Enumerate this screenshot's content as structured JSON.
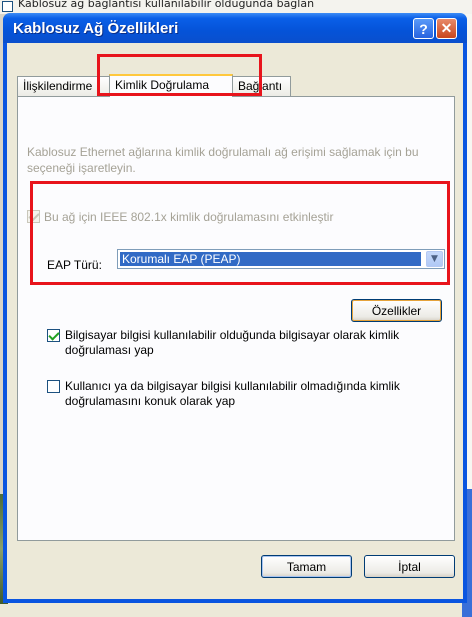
{
  "background": {
    "partial_text": "Kablosuz ağ bağlantısı kullanılabilir olduğunda bağlan"
  },
  "window": {
    "title": "Kablosuz Ağ Özellikleri",
    "help_glyph": "?",
    "close_glyph": "✕"
  },
  "tabs": [
    {
      "label": "İlişkilendirme",
      "active": false
    },
    {
      "label": "Kimlik Doğrulama",
      "active": true
    },
    {
      "label": "Bağlantı",
      "active": false
    }
  ],
  "auth": {
    "description": "Kablosuz Ethernet ağlarına kimlik doğrulamalı ağ erişimi sağlamak için bu seçeneği işaretleyin.",
    "ieee_checkbox_label": "Bu ağ için IEEE 802.1x kimlik doğrulamasını etkinleştir",
    "ieee_checked": true,
    "ieee_enabled": false,
    "eap_label": "EAP Türü:",
    "eap_value": "Korumalı EAP (PEAP)",
    "properties_button": "Özellikler",
    "option_computer_label": "Bilgisayar bilgisi kullanılabilir olduğunda bilgisayar olarak kimlik doğrulaması yap",
    "option_computer_checked": true,
    "option_guest_label": "Kullanıcı ya da bilgisayar bilgisi kullanılabilir olmadığında kimlik doğrulamasını konuk olarak yap",
    "option_guest_checked": false
  },
  "buttons": {
    "ok": "Tamam",
    "cancel": "İptal"
  },
  "colors": {
    "title_bar": "#0553d8",
    "highlight_box": "#e8141c",
    "selection": "#316ac5"
  }
}
